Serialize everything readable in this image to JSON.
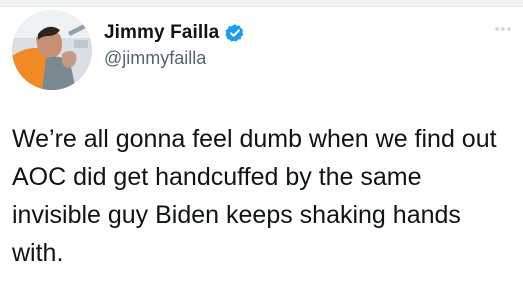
{
  "author": {
    "display_name": "Jimmy Failla",
    "handle": "@jimmyfailla",
    "verified": true
  },
  "tweet": {
    "text": "We’re all gonna feel dumb when we find out AOC did get handcuffed by the same invisible guy Biden keeps shaking hands with."
  },
  "icons": {
    "avatar": "avatar-photo",
    "verified": "verified-badge-icon",
    "more": "more-options-icon"
  },
  "colors": {
    "text": "#0f1419",
    "secondary_text": "#536471",
    "verified_blue": "#1d9bf0"
  }
}
